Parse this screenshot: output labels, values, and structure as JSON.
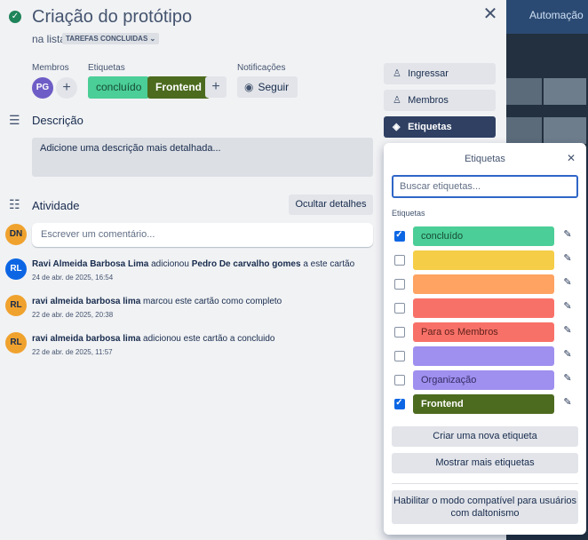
{
  "background": {
    "header_text": "Automação"
  },
  "card": {
    "title": "Criação do protótipo",
    "in_list_prefix": "na lista",
    "list_name": "TAREFAS CONCLUIDAS",
    "close_symbol": "✕"
  },
  "members": {
    "label": "Membros",
    "avatar_initials": "PG",
    "avatar_color": "#6e5dc6"
  },
  "labels_section": {
    "label": "Etiquetas",
    "chips": [
      {
        "text": "concluído",
        "color": "#4bce97"
      },
      {
        "text": "Frontend",
        "color": "#4c6b1f"
      }
    ]
  },
  "notifications": {
    "label": "Notificações",
    "follow_label": "Seguir"
  },
  "description": {
    "title": "Descrição",
    "placeholder": "Adicione uma descrição mais detalhada..."
  },
  "activity": {
    "title": "Atividade",
    "hide_details_label": "Ocultar detalhes",
    "comment_avatar": "DN",
    "comment_placeholder": "Escrever um comentário...",
    "items": [
      {
        "avatar": "RL",
        "avatar_color": "#0c66e4",
        "user": "Ravi Almeida Barbosa Lima",
        "action": " adicionou ",
        "target": "Pedro De carvalho gomes",
        "tail": " a este cartão",
        "time": "24 de abr. de 2025, 16:54"
      },
      {
        "avatar": "RL",
        "avatar_color": "#f0a22e",
        "user": "ravi almeida barbosa lima",
        "action": " marcou este cartão como completo",
        "target": "",
        "tail": "",
        "time": "22 de abr. de 2025, 20:38"
      },
      {
        "avatar": "RL",
        "avatar_color": "#f0a22e",
        "user": "ravi almeida barbosa lima",
        "action": " adicionou este cartão a concluido",
        "target": "",
        "tail": "",
        "time": "22 de abr. de 2025, 11:57"
      }
    ]
  },
  "sidebar": {
    "join_label": "Ingressar",
    "members_label": "Membros",
    "labels_label": "Etiquetas"
  },
  "labels_popover": {
    "title": "Etiquetas",
    "search_placeholder": "Buscar etiquetas...",
    "section_label": "Etiquetas",
    "items": [
      {
        "name": "concluído",
        "color": "#4bce97",
        "text_color": "#164b35",
        "checked": true
      },
      {
        "name": "",
        "color": "#f5cd47",
        "text_color": "#172b4d",
        "checked": false
      },
      {
        "name": "",
        "color": "#fea362",
        "text_color": "#172b4d",
        "checked": false
      },
      {
        "name": "",
        "color": "#f87168",
        "text_color": "#172b4d",
        "checked": false
      },
      {
        "name": "Para os Membros",
        "color": "#f87168",
        "text_color": "#5d1f1a",
        "checked": false
      },
      {
        "name": "",
        "color": "#9f8fef",
        "text_color": "#172b4d",
        "checked": false
      },
      {
        "name": "Organização",
        "color": "#9f8fef",
        "text_color": "#352c63",
        "checked": false
      },
      {
        "name": "Frontend",
        "color": "#4c6b1f",
        "text_color": "#ffffff",
        "checked": true
      }
    ],
    "create_label": "Criar uma nova etiqueta",
    "more_label": "Mostrar mais etiquetas",
    "colorblind_label": "Habilitar o modo compatível para usuários com daltonismo"
  }
}
